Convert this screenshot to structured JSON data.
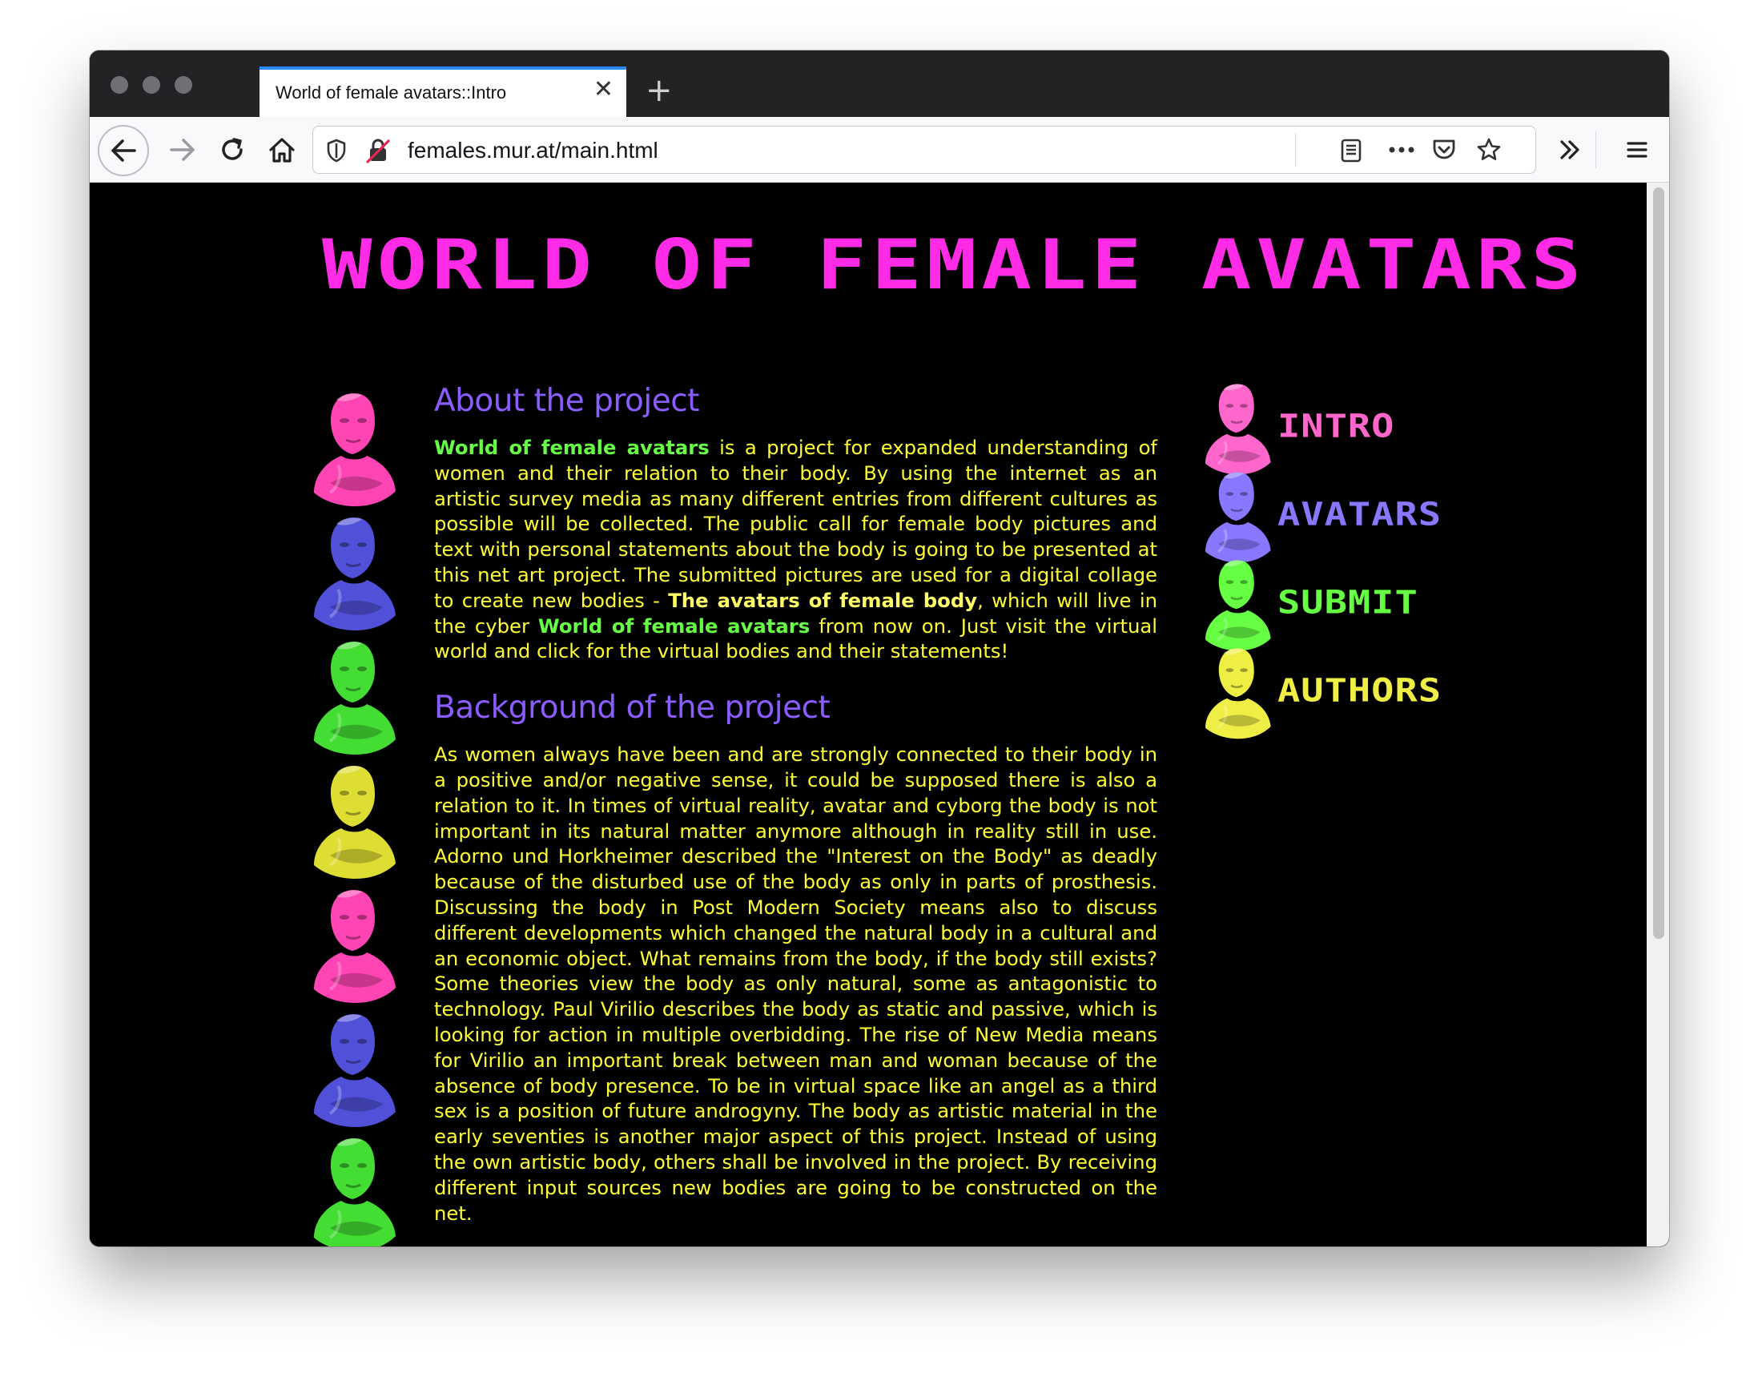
{
  "browser": {
    "tab_title": "World of female avatars::Intro",
    "url": "females.mur.at/main.html"
  },
  "colors": {
    "title": "#ff2be6",
    "heading": "#8b5cff",
    "text": "#ffff33",
    "highlight_green": "#66ff44",
    "highlight_yellow": "#ffff66",
    "background": "#000000"
  },
  "site": {
    "title": "World of Female Avatars"
  },
  "sections": {
    "about": {
      "heading": "About the project",
      "p_name_1": "World of female avatars",
      "p_text_1": " is a project for expanded understanding of women and their relation to their body. By using the internet as an artistic survey media as many different entries from different cultures as possible will be collected. The public call for female body pictures and text with personal statements about the body is going to be presented at this net art project. The submitted pictures are used for a digital collage to create new bodies - ",
      "p_name_2": "The avatars of female body",
      "p_text_2": ", which will live in the cyber ",
      "p_name_3": "World of female avatars",
      "p_text_3": " from now on. Just visit the virtual world and click for the virtual bodies and their statements!"
    },
    "background": {
      "heading": "Background of the project",
      "text": "As women always have been and are strongly connected to their body in a positive and/or negative sense, it could be supposed there is also a relation to it. In times of virtual reality, avatar and cyborg the body is not important in its natural matter anymore although in reality still in use. Adorno und Horkheimer described the \"Interest on the Body\" as deadly because of the disturbed use of the body as only in parts of prosthesis. Discussing the body in Post Modern Society means also to discuss different developments which changed the natural body in a cultural and an economic object. What remains from the body, if the body still exists? Some theories view the body as only natural, some as antagonistic to technology. Paul Virilio describes the body as static and passive, which is looking for action in multiple overbidding. The rise of New Media means for Virilio an important break between man and woman because of the absence of body presence. To be in virtual space like an angel as a third sex is a position of future androgyny. The body as artistic material in the early seventies is another major aspect of this project. Instead of using the own artistic body, others shall be involved in the project. By receiving different input sources new bodies are going to be constructed on the net."
    }
  },
  "menu": {
    "intro": {
      "label": "Intro",
      "color": "#ff66cc"
    },
    "avatars": {
      "label": "Avatars",
      "color": "#8877ff"
    },
    "submit": {
      "label": "Submit",
      "color": "#66ff44"
    },
    "authors": {
      "label": "Authors",
      "color": "#eeee44"
    }
  },
  "avatar_colors": [
    "#ff44b4",
    "#5050d8",
    "#44dd33",
    "#dddd33",
    "#ff44b4",
    "#5050d8",
    "#44dd33"
  ]
}
